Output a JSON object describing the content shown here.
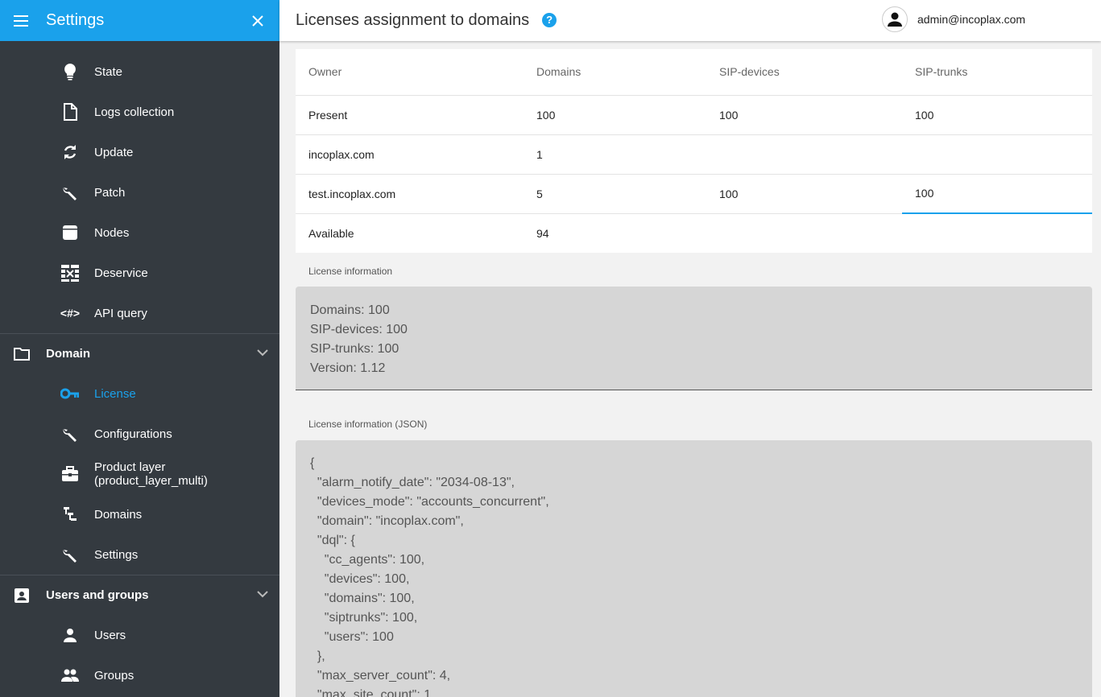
{
  "sidebar": {
    "title": "Settings",
    "items_top": [
      {
        "label": "State",
        "icon": "lightbulb-icon"
      },
      {
        "label": "Logs collection",
        "icon": "file-icon"
      },
      {
        "label": "Update",
        "icon": "sync-icon"
      },
      {
        "label": "Patch",
        "icon": "wrench-icon"
      },
      {
        "label": "Nodes",
        "icon": "box-icon"
      },
      {
        "label": "Deservice",
        "icon": "wall-icon"
      },
      {
        "label": "API query",
        "icon": "code-icon"
      }
    ],
    "group_domain": {
      "label": "Domain",
      "items": [
        {
          "label": "License",
          "icon": "key-icon",
          "active": true
        },
        {
          "label": "Configurations",
          "icon": "wrench-icon"
        },
        {
          "label": "Product layer (product_layer_multi)",
          "icon": "briefcase-icon"
        },
        {
          "label": "Domains",
          "icon": "tree-icon"
        },
        {
          "label": "Settings",
          "icon": "wrench-icon"
        }
      ]
    },
    "group_users": {
      "label": "Users and groups",
      "items": [
        {
          "label": "Users",
          "icon": "person-icon"
        },
        {
          "label": "Groups",
          "icon": "group-icon"
        }
      ]
    }
  },
  "header": {
    "title": "Licenses assignment to domains",
    "help": "?",
    "user": "admin@incoplax.com"
  },
  "table": {
    "columns": [
      "Owner",
      "Domains",
      "SIP-devices",
      "SIP-trunks"
    ],
    "rows": [
      [
        "Present",
        "100",
        "100",
        "100"
      ],
      [
        "incoplax.com",
        "1",
        "",
        ""
      ],
      [
        "test.incoplax.com",
        "5",
        "100",
        "100"
      ],
      [
        "Available",
        "94",
        "",
        ""
      ]
    ]
  },
  "license_info": {
    "label": "License information",
    "lines": [
      "Domains: 100",
      "SIP-devices: 100",
      "SIP-trunks: 100",
      "Version: 1.12"
    ]
  },
  "license_json": {
    "label": "License information (JSON)",
    "text": "{\n  \"alarm_notify_date\": \"2034-08-13\",\n  \"devices_mode\": \"accounts_concurrent\",\n  \"domain\": \"incoplax.com\",\n  \"dql\": {\n    \"cc_agents\": 100,\n    \"devices\": 100,\n    \"domains\": 100,\n    \"siptrunks\": 100,\n    \"users\": 100\n  },\n  \"max_server_count\": 4,\n  \"max_site_count\": 1,"
  },
  "colors": {
    "accent": "#1aa1eb",
    "sidebar_bg": "#343a40"
  }
}
